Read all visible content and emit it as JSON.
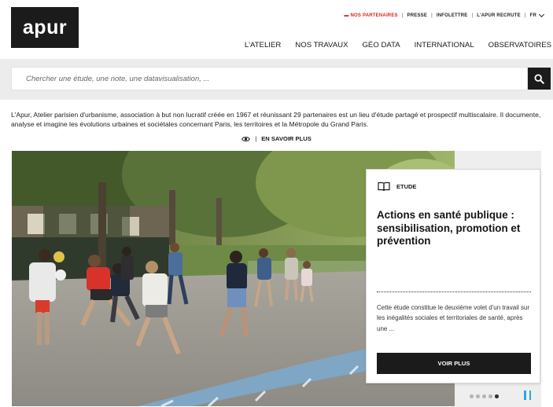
{
  "logo": {
    "text": "apur"
  },
  "top_links": {
    "partners": "NOS PARTENAIRES",
    "press": "PRESSE",
    "newsletter": "INFOLETTRE",
    "jobs": "L'APUR RECRUTE",
    "lang": "FR"
  },
  "nav": [
    "L'ATELIER",
    "NOS TRAVAUX",
    "GÉO DATA",
    "INTERNATIONAL",
    "OBSERVATOIRES"
  ],
  "search": {
    "placeholder": "Chercher une étude, une note, une datavisualisation, ..."
  },
  "intro": "L'Apur, Atelier parisien d'urbanisme, association à but non lucratif créée en 1967 et réunissant 29 partenaires est un lieu d'étude partagé et prospectif multiscalaire. Il documente, analyse et imagine les évolutions urbaines et sociétales concernant Paris, les territoires et la Métropole du Grand Paris.",
  "more": {
    "label": "EN SAVOIR PLUS"
  },
  "feature": {
    "kind": "ETUDE",
    "title": "Actions en santé publique : sensibilisation, promotion et prévention",
    "excerpt": "Cette étude constitue le deuxième volet d'un travail sur les inégalités sociales et territoriales de santé, après une ...",
    "button": "VOIR PLUS"
  },
  "slider": {
    "slide_count": 5,
    "active_index": 4
  },
  "colors": {
    "dark": "#1b1b1b",
    "accent_red": "#d6261d",
    "accent_blue": "#2ea6d8"
  }
}
